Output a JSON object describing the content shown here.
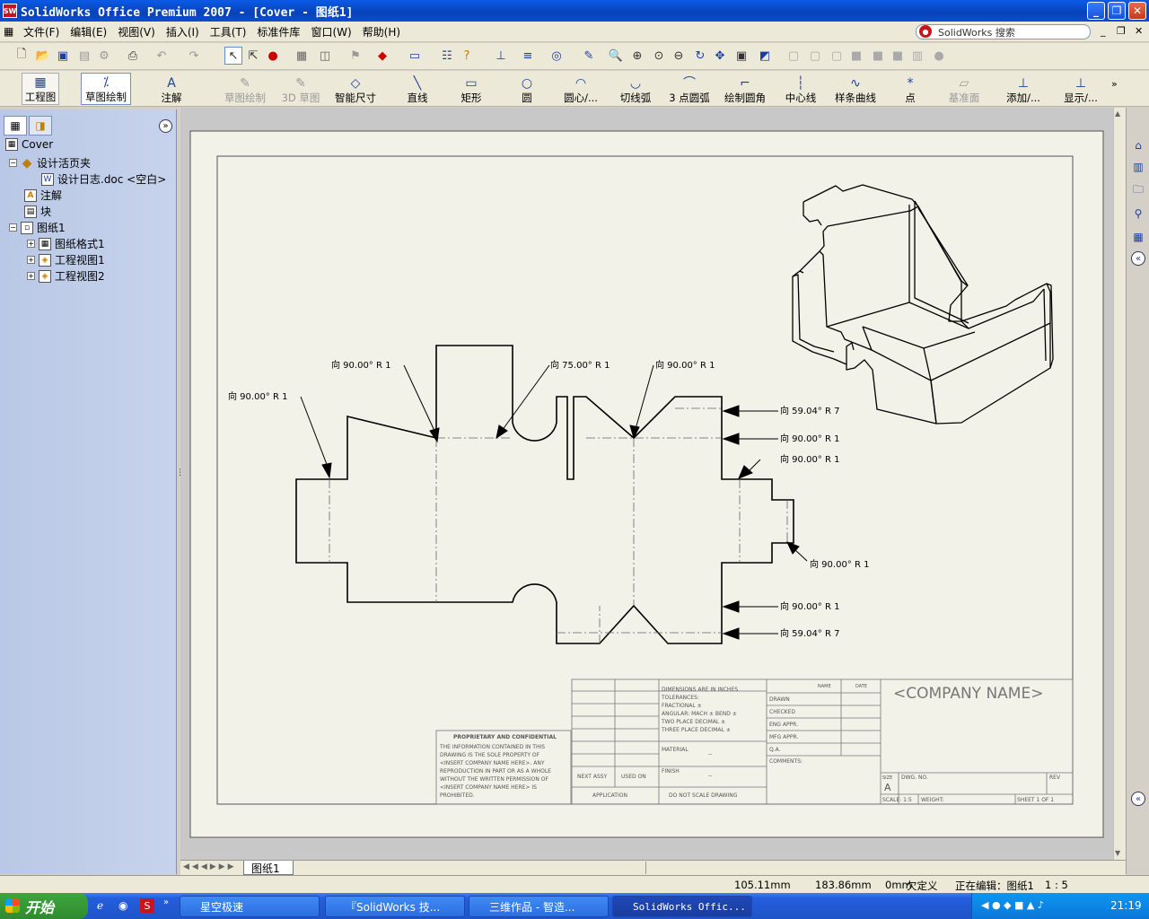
{
  "window": {
    "title": "SolidWorks Office Premium 2007 - [Cover - 图纸1]",
    "logo": "SW"
  },
  "menu": [
    "文件(F)",
    "编辑(E)",
    "视图(V)",
    "插入(I)",
    "工具(T)",
    "标准件库",
    "窗口(W)",
    "帮助(H)"
  ],
  "search": {
    "placeholder": "SolidWorks 搜索"
  },
  "command_manager": [
    {
      "label": "工程图",
      "icon": "drawing-icon",
      "enabled": true
    },
    {
      "label": "草图绘制",
      "icon": "sketch-icon",
      "enabled": true
    },
    {
      "label": "注解",
      "icon": "annotation-icon",
      "enabled": true
    },
    {
      "label": "草图绘制",
      "icon": "sketch-draw-icon",
      "enabled": false
    },
    {
      "label": "3D 草图",
      "icon": "3d-sketch-icon",
      "enabled": false
    },
    {
      "label": "智能尺寸",
      "icon": "smart-dimension-icon",
      "enabled": true
    },
    {
      "label": "直线",
      "icon": "line-icon",
      "enabled": true
    },
    {
      "label": "矩形",
      "icon": "rectangle-icon",
      "enabled": true
    },
    {
      "label": "圆",
      "icon": "circle-icon",
      "enabled": true
    },
    {
      "label": "圆心/...",
      "icon": "center-arc-icon",
      "enabled": true
    },
    {
      "label": "切线弧",
      "icon": "tangent-arc-icon",
      "enabled": true
    },
    {
      "label": "3 点圆弧",
      "icon": "three-point-arc-icon",
      "enabled": true
    },
    {
      "label": "绘制圆角",
      "icon": "fillet-icon",
      "enabled": true
    },
    {
      "label": "中心线",
      "icon": "centerline-icon",
      "enabled": true
    },
    {
      "label": "样条曲线",
      "icon": "spline-icon",
      "enabled": true
    },
    {
      "label": "点",
      "icon": "point-icon",
      "enabled": true
    },
    {
      "label": "基准面",
      "icon": "plane-icon",
      "enabled": false
    },
    {
      "label": "添加/...",
      "icon": "add-relation-icon",
      "enabled": true
    },
    {
      "label": "显示/...",
      "icon": "display-relation-icon",
      "enabled": true
    }
  ],
  "tree": {
    "root": "Cover",
    "items": [
      {
        "label": "设计活页夹",
        "level": 1
      },
      {
        "label": "设计日志.doc <空白>",
        "level": 2
      },
      {
        "label": "注解",
        "level": 1
      },
      {
        "label": "块",
        "level": 1
      },
      {
        "label": "图纸1",
        "level": 1
      },
      {
        "label": "图纸格式1",
        "level": 2
      },
      {
        "label": "工程视图1",
        "level": 2
      },
      {
        "label": "工程视图2",
        "level": 2
      }
    ]
  },
  "drawing": {
    "bend_notes": [
      "向 90.00° R 1",
      "向 90.00° R 1",
      "向 75.00° R 1",
      "向 90.00° R 1",
      "向 59.04° R 7",
      "向 90.00° R 1",
      "向 90.00° R 1",
      "向 90.00° R 1",
      "向 90.00° R 1",
      "向 59.04° R 7"
    ],
    "title_block": {
      "company": "<COMPANY NAME>",
      "dimensions_note": [
        "DIMENSIONS ARE IN INCHES",
        "TOLERANCES:",
        "FRACTIONAL ±",
        "ANGULAR: MACH ±   BEND ±",
        "TWO PLACE DECIMAL   ±",
        "THREE PLACE DECIMAL  ±"
      ],
      "material": "MATERIAL",
      "finish": "FINISH",
      "dash": "--",
      "next_assy": "NEXT ASSY",
      "used_on": "USED ON",
      "application": "APPLICATION",
      "do_not_scale": "DO NOT SCALE DRAWING",
      "roles": [
        "DRAWN",
        "CHECKED",
        "ENG APPR.",
        "MFG APPR.",
        "Q.A.",
        "COMMENTS:"
      ],
      "name_col": "NAME",
      "date_col": "DATE",
      "size_label": "SIZE",
      "size": "A",
      "dwg_no": "DWG. NO.",
      "rev": "REV",
      "scale": "SCALE: 1:5",
      "weight": "WEIGHT:",
      "sheet": "SHEET 1 OF 1",
      "proprietary_title": "PROPRIETARY AND CONFIDENTIAL",
      "proprietary_text": [
        "THE INFORMATION CONTAINED IN THIS",
        "DRAWING IS THE SOLE PROPERTY OF",
        "<INSERT COMPANY NAME HERE>. ANY",
        "REPRODUCTION IN PART OR AS A WHOLE",
        "WITHOUT THE WRITTEN PERMISSION OF",
        "<INSERT COMPANY NAME HERE> IS",
        "PROHIBITED."
      ]
    }
  },
  "sheet_tab": "图纸1",
  "status": {
    "x": "105.11mm",
    "y": "183.86mm",
    "z": "0mm",
    "state": "欠定义",
    "editing": "正在编辑：图纸1",
    "scale": "1 : 5"
  },
  "taskbar": {
    "start": "开始",
    "tasks": [
      "星空极速",
      "『SolidWorks 技...",
      "三维作品 - 智造...",
      "SolidWorks Offic..."
    ],
    "clock": "21:19"
  },
  "colors": {
    "title_blue": "#0842b8",
    "sheet_bg": "#f4f4ec",
    "taskbar": "#245edb",
    "start_green": "#3ca63c"
  }
}
